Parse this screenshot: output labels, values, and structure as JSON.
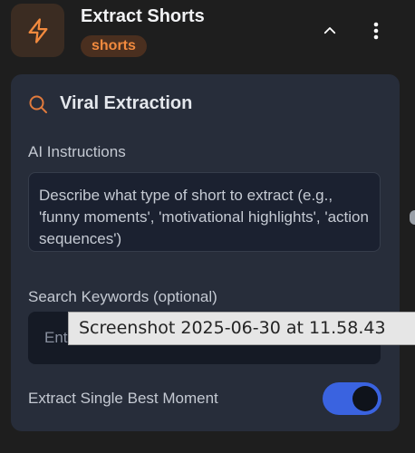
{
  "node": {
    "icon": "lightning-bolt-icon",
    "title": "Extract Shorts",
    "badge": "shorts",
    "collapse_icon": "chevron-up-icon",
    "menu_icon": "more-vertical-icon"
  },
  "section": {
    "icon": "search-icon",
    "title": "Viral Extraction"
  },
  "ai_instructions": {
    "label": "AI Instructions",
    "placeholder": "Describe what type of short to extract (e.g., 'funny moments', 'motivational highlights', 'action sequences')"
  },
  "keywords": {
    "label": "Search Keywords (optional)",
    "visible_text": "Ente"
  },
  "single_best": {
    "label": "Extract Single Best Moment",
    "enabled": true
  },
  "tooltip": {
    "text": "Screenshot 2025-06-30 at 11.58.43"
  },
  "colors": {
    "accent": "#f28a3e",
    "panel": "#272d3a",
    "toggle_on": "#3a63e0",
    "background": "#1e1e1e"
  }
}
